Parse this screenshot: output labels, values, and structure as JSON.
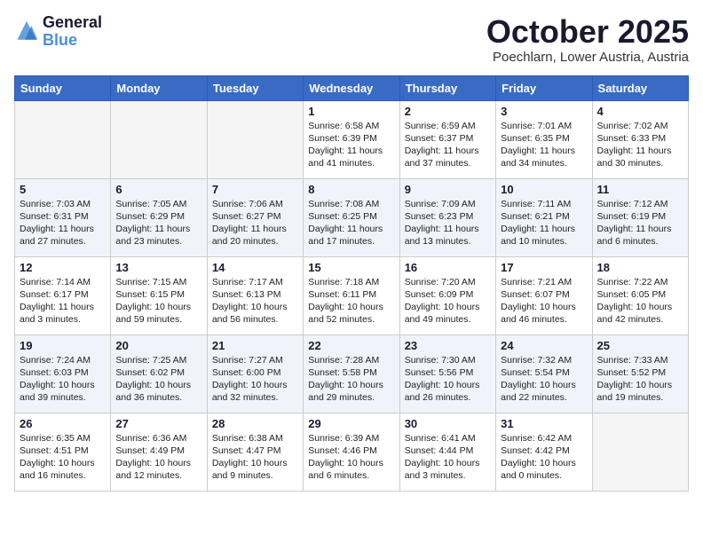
{
  "header": {
    "logo_line1": "General",
    "logo_line2": "Blue",
    "month": "October 2025",
    "location": "Poechlarn, Lower Austria, Austria"
  },
  "weekdays": [
    "Sunday",
    "Monday",
    "Tuesday",
    "Wednesday",
    "Thursday",
    "Friday",
    "Saturday"
  ],
  "weeks": [
    [
      {
        "day": "",
        "info": ""
      },
      {
        "day": "",
        "info": ""
      },
      {
        "day": "",
        "info": ""
      },
      {
        "day": "1",
        "info": "Sunrise: 6:58 AM\nSunset: 6:39 PM\nDaylight: 11 hours\nand 41 minutes."
      },
      {
        "day": "2",
        "info": "Sunrise: 6:59 AM\nSunset: 6:37 PM\nDaylight: 11 hours\nand 37 minutes."
      },
      {
        "day": "3",
        "info": "Sunrise: 7:01 AM\nSunset: 6:35 PM\nDaylight: 11 hours\nand 34 minutes."
      },
      {
        "day": "4",
        "info": "Sunrise: 7:02 AM\nSunset: 6:33 PM\nDaylight: 11 hours\nand 30 minutes."
      }
    ],
    [
      {
        "day": "5",
        "info": "Sunrise: 7:03 AM\nSunset: 6:31 PM\nDaylight: 11 hours\nand 27 minutes."
      },
      {
        "day": "6",
        "info": "Sunrise: 7:05 AM\nSunset: 6:29 PM\nDaylight: 11 hours\nand 23 minutes."
      },
      {
        "day": "7",
        "info": "Sunrise: 7:06 AM\nSunset: 6:27 PM\nDaylight: 11 hours\nand 20 minutes."
      },
      {
        "day": "8",
        "info": "Sunrise: 7:08 AM\nSunset: 6:25 PM\nDaylight: 11 hours\nand 17 minutes."
      },
      {
        "day": "9",
        "info": "Sunrise: 7:09 AM\nSunset: 6:23 PM\nDaylight: 11 hours\nand 13 minutes."
      },
      {
        "day": "10",
        "info": "Sunrise: 7:11 AM\nSunset: 6:21 PM\nDaylight: 11 hours\nand 10 minutes."
      },
      {
        "day": "11",
        "info": "Sunrise: 7:12 AM\nSunset: 6:19 PM\nDaylight: 11 hours\nand 6 minutes."
      }
    ],
    [
      {
        "day": "12",
        "info": "Sunrise: 7:14 AM\nSunset: 6:17 PM\nDaylight: 11 hours\nand 3 minutes."
      },
      {
        "day": "13",
        "info": "Sunrise: 7:15 AM\nSunset: 6:15 PM\nDaylight: 10 hours\nand 59 minutes."
      },
      {
        "day": "14",
        "info": "Sunrise: 7:17 AM\nSunset: 6:13 PM\nDaylight: 10 hours\nand 56 minutes."
      },
      {
        "day": "15",
        "info": "Sunrise: 7:18 AM\nSunset: 6:11 PM\nDaylight: 10 hours\nand 52 minutes."
      },
      {
        "day": "16",
        "info": "Sunrise: 7:20 AM\nSunset: 6:09 PM\nDaylight: 10 hours\nand 49 minutes."
      },
      {
        "day": "17",
        "info": "Sunrise: 7:21 AM\nSunset: 6:07 PM\nDaylight: 10 hours\nand 46 minutes."
      },
      {
        "day": "18",
        "info": "Sunrise: 7:22 AM\nSunset: 6:05 PM\nDaylight: 10 hours\nand 42 minutes."
      }
    ],
    [
      {
        "day": "19",
        "info": "Sunrise: 7:24 AM\nSunset: 6:03 PM\nDaylight: 10 hours\nand 39 minutes."
      },
      {
        "day": "20",
        "info": "Sunrise: 7:25 AM\nSunset: 6:02 PM\nDaylight: 10 hours\nand 36 minutes."
      },
      {
        "day": "21",
        "info": "Sunrise: 7:27 AM\nSunset: 6:00 PM\nDaylight: 10 hours\nand 32 minutes."
      },
      {
        "day": "22",
        "info": "Sunrise: 7:28 AM\nSunset: 5:58 PM\nDaylight: 10 hours\nand 29 minutes."
      },
      {
        "day": "23",
        "info": "Sunrise: 7:30 AM\nSunset: 5:56 PM\nDaylight: 10 hours\nand 26 minutes."
      },
      {
        "day": "24",
        "info": "Sunrise: 7:32 AM\nSunset: 5:54 PM\nDaylight: 10 hours\nand 22 minutes."
      },
      {
        "day": "25",
        "info": "Sunrise: 7:33 AM\nSunset: 5:52 PM\nDaylight: 10 hours\nand 19 minutes."
      }
    ],
    [
      {
        "day": "26",
        "info": "Sunrise: 6:35 AM\nSunset: 4:51 PM\nDaylight: 10 hours\nand 16 minutes."
      },
      {
        "day": "27",
        "info": "Sunrise: 6:36 AM\nSunset: 4:49 PM\nDaylight: 10 hours\nand 12 minutes."
      },
      {
        "day": "28",
        "info": "Sunrise: 6:38 AM\nSunset: 4:47 PM\nDaylight: 10 hours\nand 9 minutes."
      },
      {
        "day": "29",
        "info": "Sunrise: 6:39 AM\nSunset: 4:46 PM\nDaylight: 10 hours\nand 6 minutes."
      },
      {
        "day": "30",
        "info": "Sunrise: 6:41 AM\nSunset: 4:44 PM\nDaylight: 10 hours\nand 3 minutes."
      },
      {
        "day": "31",
        "info": "Sunrise: 6:42 AM\nSunset: 4:42 PM\nDaylight: 10 hours\nand 0 minutes."
      },
      {
        "day": "",
        "info": ""
      }
    ]
  ]
}
